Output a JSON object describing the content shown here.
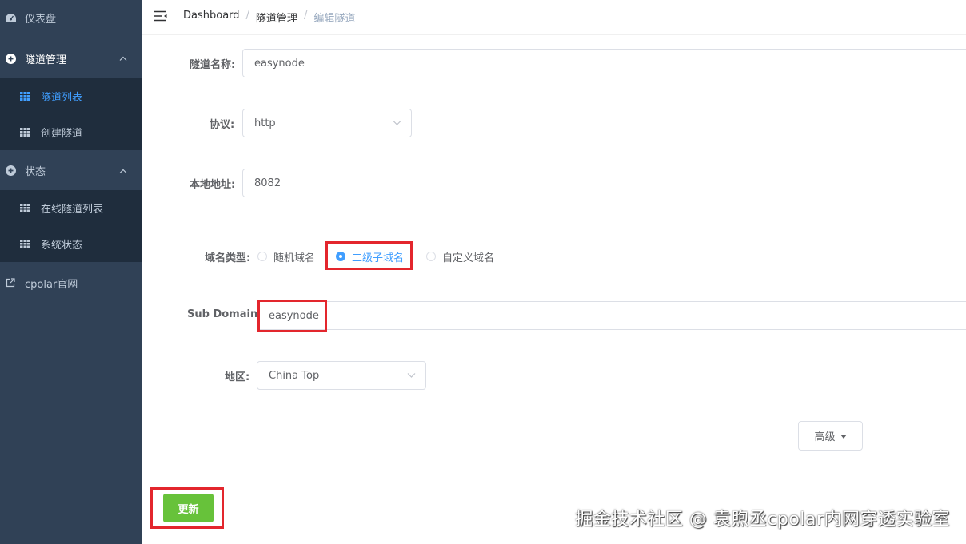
{
  "sidebar": {
    "items": [
      {
        "label": "仪表盘",
        "icon": "dashboard-icon"
      },
      {
        "label": "隧道管理",
        "icon": "plus-circle-icon",
        "expanded": true
      },
      {
        "label": "隧道列表",
        "icon": "grid-icon",
        "active": true
      },
      {
        "label": "创建隧道",
        "icon": "grid-icon"
      },
      {
        "label": "状态",
        "icon": "plus-circle-icon",
        "expanded": true
      },
      {
        "label": "在线隧道列表",
        "icon": "grid-icon"
      },
      {
        "label": "系统状态",
        "icon": "grid-icon"
      },
      {
        "label": "cpolar官网",
        "icon": "external-link-icon"
      }
    ]
  },
  "header": {
    "breadcrumb": [
      "Dashboard",
      "隧道管理",
      "编辑隧道"
    ]
  },
  "form": {
    "tunnel_name_label": "隧道名称:",
    "tunnel_name_value": "easynode",
    "protocol_label": "协议:",
    "protocol_value": "http",
    "local_address_label": "本地地址:",
    "local_address_value": "8082",
    "domain_type_label": "域名类型:",
    "domain_type_options": [
      "随机域名",
      "二级子域名",
      "自定义域名"
    ],
    "domain_type_selected": "二级子域名",
    "subdomain_label": "Sub Domain:",
    "subdomain_value": "easynode",
    "region_label": "地区:",
    "region_value": "China Top",
    "advanced_label": "高级",
    "update_label": "更新"
  },
  "watermark": "掘金技术社区 @ 袁煦丞cpolar内网穿透实验室",
  "colors": {
    "sidebar_bg": "#304156",
    "submenu_bg": "#1f2d3d",
    "active_text": "#409eff",
    "primary": "#409eff",
    "success": "#67c23a",
    "highlight": "#e3262d"
  }
}
